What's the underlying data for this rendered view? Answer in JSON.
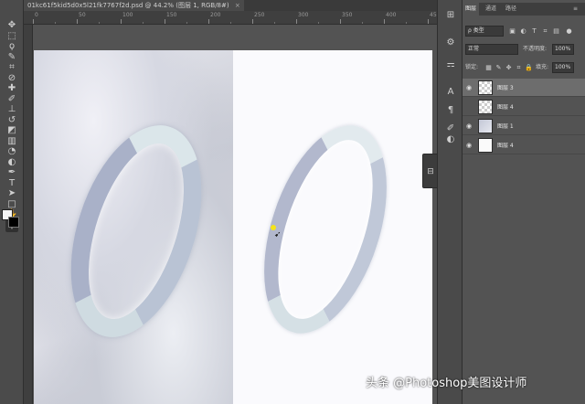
{
  "document": {
    "tab_title": "01kc61f5kid5d0x5l21fk7767f2d.psd @ 44.2% (图层 1, RGB/8#)",
    "tab_close": "×"
  },
  "ruler": {
    "numbers": [
      "0",
      "50",
      "100",
      "150",
      "200",
      "250",
      "300",
      "350",
      "400",
      "450"
    ]
  },
  "toolbar": {
    "tools": [
      {
        "name": "move-tool",
        "glyph": "✥"
      },
      {
        "name": "marquee-tool",
        "glyph": "⬚"
      },
      {
        "name": "lasso-tool",
        "glyph": "ϙ"
      },
      {
        "name": "quick-select-tool",
        "glyph": "✎"
      },
      {
        "name": "crop-tool",
        "glyph": "⌗"
      },
      {
        "name": "eyedropper-tool",
        "glyph": "⊘"
      },
      {
        "name": "healing-brush-tool",
        "glyph": "✚"
      },
      {
        "name": "brush-tool",
        "glyph": "✐"
      },
      {
        "name": "clone-stamp-tool",
        "glyph": "⊥"
      },
      {
        "name": "history-brush-tool",
        "glyph": "↺"
      },
      {
        "name": "eraser-tool",
        "glyph": "◩"
      },
      {
        "name": "gradient-tool",
        "glyph": "▥"
      },
      {
        "name": "blur-tool",
        "glyph": "◔"
      },
      {
        "name": "dodge-tool",
        "glyph": "◐"
      },
      {
        "name": "pen-tool",
        "glyph": "✒"
      },
      {
        "name": "type-tool",
        "glyph": "T"
      },
      {
        "name": "path-select-tool",
        "glyph": "➤"
      },
      {
        "name": "shape-tool",
        "glyph": "□"
      },
      {
        "name": "hand-tool",
        "glyph": "✋"
      },
      {
        "name": "zoom-tool",
        "glyph": "⚲"
      }
    ]
  },
  "dock": {
    "icons": [
      "history-icon",
      "properties-icon",
      "adjust-icon",
      "type-icon",
      "paragraph-icon",
      "brush-panel-icon",
      "color-icon"
    ],
    "glyphs": [
      "⊞",
      "⚙",
      "⚎",
      "A",
      "¶",
      "✐",
      "◐"
    ],
    "float_glyph": "⊟"
  },
  "layers_panel": {
    "tabs": [
      "图层",
      "通道",
      "路径"
    ],
    "filter_kind": "ρ 类型",
    "blend_mode": "正常",
    "opacity_label": "不透明度:",
    "opacity_value": "100%",
    "lock_label": "锁定:",
    "fill_label": "填充:",
    "fill_value": "100%",
    "layers": [
      {
        "name": "图层 3",
        "thumb": "transparent",
        "selected": true,
        "visible": true
      },
      {
        "name": "图层 4",
        "thumb": "transparent",
        "selected": false,
        "visible": false
      },
      {
        "name": "图层 1",
        "thumb": "image",
        "selected": false,
        "visible": true
      },
      {
        "name": "图层 4",
        "thumb": "white",
        "selected": false,
        "visible": true
      }
    ]
  },
  "watermark": "头条 @Photoshop美图设计师"
}
